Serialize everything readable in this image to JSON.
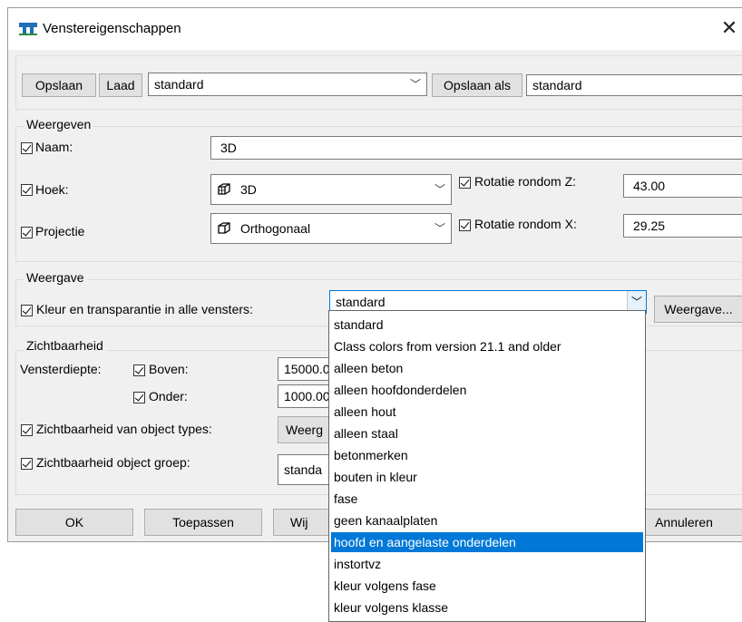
{
  "window": {
    "title": "Venstereigenschappen",
    "close": "✕",
    "icon": "app-icon"
  },
  "toolbar": {
    "save_label": "Opslaan",
    "load_label": "Laad",
    "preset_value": "standard",
    "save_as_label": "Opslaan als",
    "save_as_value": "standard"
  },
  "weergeven": {
    "group_label": "Weergeven",
    "name_label": "Naam:",
    "name_value": "3D",
    "angle_label": "Hoek:",
    "angle_value": "3D",
    "rot_z_label": "Rotatie rondom Z:",
    "rot_z_value": "43.00",
    "projection_label": "Projectie",
    "projection_value": "Orthogonaal",
    "rot_x_label": "Rotatie rondom X:",
    "rot_x_value": "29.25"
  },
  "weergave": {
    "group_label": "Weergave",
    "color_label": "Kleur en transparantie in alle vensters:",
    "color_value": "standard",
    "display_button": "Weergave..."
  },
  "zichtbaarheid": {
    "group_label": "Zichtbaarheid",
    "depth_label": "Vensterdiepte:",
    "top_label": "Boven:",
    "top_value": "15000.0",
    "bottom_label": "Onder:",
    "bottom_value": "1000.00",
    "object_types_label": "Zichtbaarheid van object types:",
    "object_types_button": "Weerg",
    "object_group_label": "Zichtbaarheid object groep:",
    "object_group_value": "standa"
  },
  "footer": {
    "ok": "OK",
    "apply": "Toepassen",
    "modify": "Wij",
    "cancel": "Annuleren"
  },
  "dropdown_options": [
    "standard",
    "Class colors from version 21.1 and older",
    "alleen beton",
    "alleen hoofdonderdelen",
    "alleen hout",
    "alleen staal",
    "betonmerken",
    "bouten in kleur",
    "fase",
    "geen kanaalplaten",
    "hoofd en aangelaste onderdelen",
    "instortvz",
    "kleur volgens fase",
    "kleur volgens klasse"
  ],
  "dropdown_selected_index": 10,
  "colors": {
    "selection": "#0078d7",
    "dialog_bg": "#f0f0f0"
  }
}
